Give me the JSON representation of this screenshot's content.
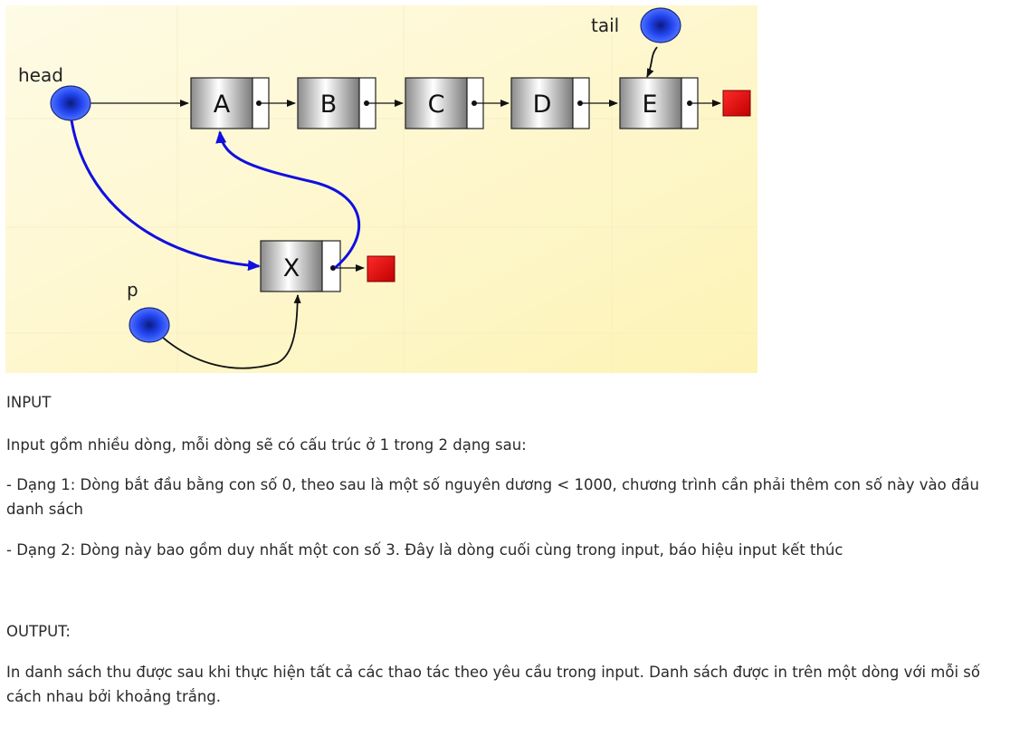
{
  "diagram": {
    "labels": {
      "head": "head",
      "tail": "tail",
      "p": "p"
    },
    "list_nodes": [
      "A",
      "B",
      "C",
      "D",
      "E"
    ],
    "new_node": "X",
    "colors": {
      "pointer": "#1a3cf0",
      "null": "#e01010",
      "new_link": "#1010e0",
      "background": "#fdf7c8"
    }
  },
  "content": {
    "input_heading": "INPUT",
    "input_desc": "Input gồm nhiều dòng, mỗi dòng sẽ có cấu trúc ở 1 trong 2 dạng sau:",
    "form1": "- Dạng 1: Dòng bắt đầu bằng con số 0, theo sau là một số nguyên dương < 1000, chương trình cần phải thêm con số này vào đầu danh sách",
    "form2": "- Dạng 2: Dòng này bao gồm duy nhất một con số 3. Đây là dòng cuối cùng trong input, báo hiệu input kết thúc",
    "output_heading": "OUTPUT:",
    "output_desc": "In danh sách thu được sau khi thực hiện tất cả các thao tác theo yêu cầu trong input. Danh sách được in trên một dòng với mỗi số cách nhau bởi khoảng trắng."
  }
}
